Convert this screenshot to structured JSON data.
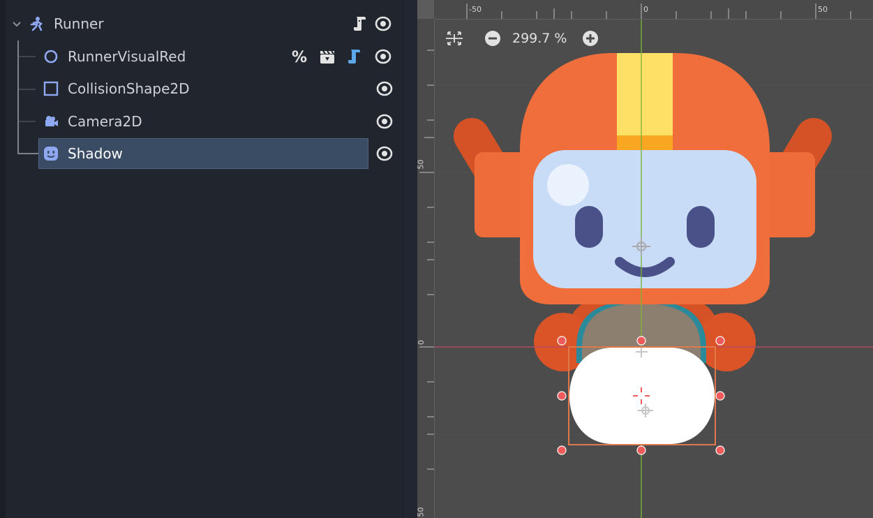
{
  "scene_tree": {
    "root": {
      "label": "Runner"
    },
    "children": [
      {
        "label": "RunnerVisualRed"
      },
      {
        "label": "CollisionShape2D"
      },
      {
        "label": "Camera2D"
      },
      {
        "label": "Shadow"
      }
    ],
    "icons": {
      "root": "character-body-icon",
      "runner_visual": "node2d-circle-icon",
      "collision": "collision-shape-icon",
      "camera": "camera-icon",
      "shadow": "sprite-icon",
      "visibility": "eye-icon",
      "script": "script-icon",
      "unique": "percent-icon",
      "scene": "clapperboard-icon"
    }
  },
  "viewport": {
    "zoom_label": "299.7 %",
    "ruler_top": [
      "-50",
      "0",
      "50"
    ],
    "ruler_left": [
      "50",
      "0",
      "50"
    ]
  },
  "colors": {
    "selection": "#3a4c63",
    "accent": "#8ea8f2",
    "orange": "#ef6e3b",
    "visor": "#c8dcf8"
  }
}
